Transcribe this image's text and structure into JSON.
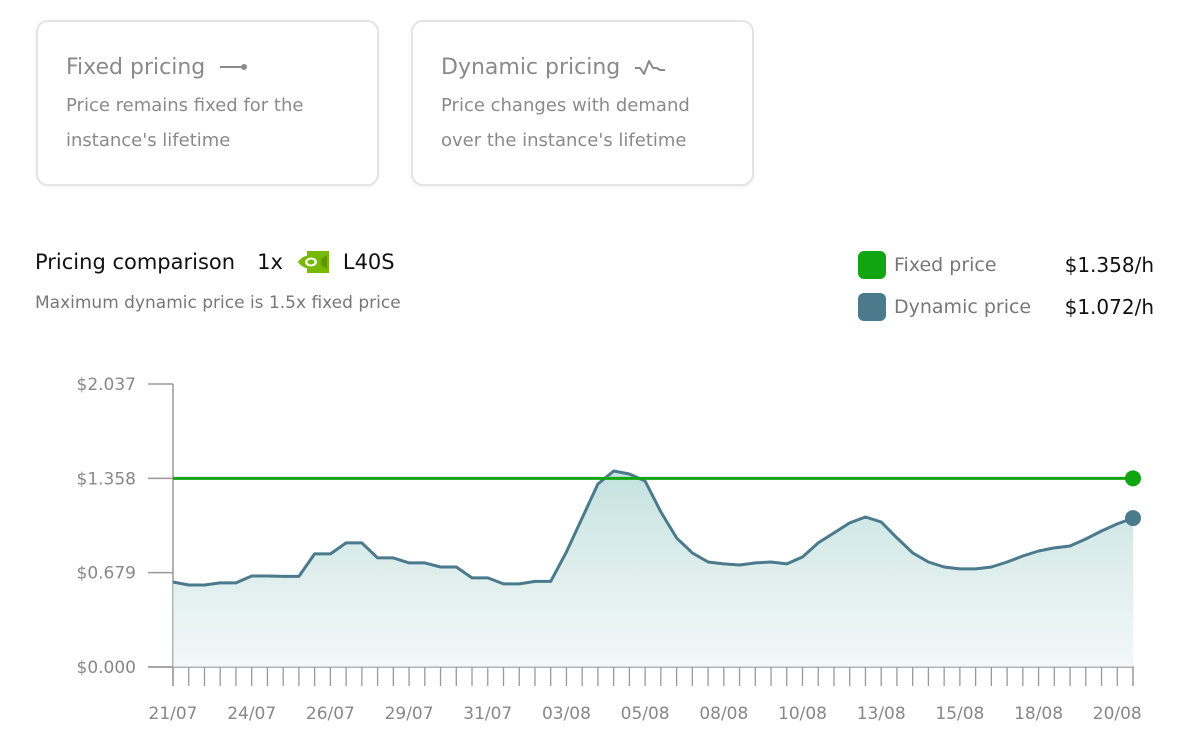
{
  "cards": [
    {
      "title": "Fixed pricing",
      "icon": "line-dot-icon",
      "desc1": "Price remains fixed for the",
      "desc2": "instance's lifetime"
    },
    {
      "title": "Dynamic pricing",
      "icon": "pulse-icon",
      "desc1": "Price changes with demand",
      "desc2": "over the instance's lifetime"
    }
  ],
  "header": {
    "title": "Pricing comparison",
    "count": "1x",
    "gpu_logo": "nvidia-logo-icon",
    "gpu": "L40S",
    "subtitle": "Maximum dynamic price is 1.5x fixed price"
  },
  "legend": [
    {
      "label": "Fixed price",
      "value": "$1.358/h",
      "color": "#11a511"
    },
    {
      "label": "Dynamic price",
      "value": "$1.072/h",
      "color": "#4a7a8c"
    }
  ],
  "chart_data": {
    "type": "line",
    "title": "Pricing comparison",
    "xlabel": "",
    "ylabel": "",
    "ylim": [
      0,
      2.037
    ],
    "yticks": [
      "$0.000",
      "$0.679",
      "$1.358",
      "$2.037"
    ],
    "ytick_values": [
      0,
      0.679,
      1.358,
      2.037
    ],
    "xtick_labels": [
      "21/07",
      "24/07",
      "26/07",
      "29/07",
      "31/07",
      "03/08",
      "05/08",
      "08/08",
      "10/08",
      "13/08",
      "15/08",
      "18/08",
      "20/08"
    ],
    "xtick_label_every": 5,
    "grid": false,
    "legend": "top-right",
    "series": [
      {
        "name": "Fixed price",
        "color": "#11a511",
        "values_constant": 1.358
      },
      {
        "name": "Dynamic price",
        "color": "#4a7a8c",
        "fill": "gradient",
        "values": [
          0.612,
          0.59,
          0.59,
          0.605,
          0.605,
          0.655,
          0.655,
          0.652,
          0.652,
          0.814,
          0.814,
          0.893,
          0.893,
          0.785,
          0.785,
          0.749,
          0.749,
          0.72,
          0.72,
          0.641,
          0.641,
          0.598,
          0.598,
          0.616,
          0.616,
          0.828,
          1.073,
          1.317,
          1.411,
          1.389,
          1.339,
          1.116,
          0.929,
          0.821,
          0.756,
          0.742,
          0.734,
          0.749,
          0.756,
          0.742,
          0.792,
          0.893,
          0.965,
          1.037,
          1.08,
          1.044,
          0.929,
          0.821,
          0.756,
          0.72,
          0.706,
          0.706,
          0.72,
          0.756,
          0.799,
          0.835,
          0.857,
          0.871,
          0.921,
          0.979,
          1.03,
          1.072
        ]
      }
    ]
  }
}
